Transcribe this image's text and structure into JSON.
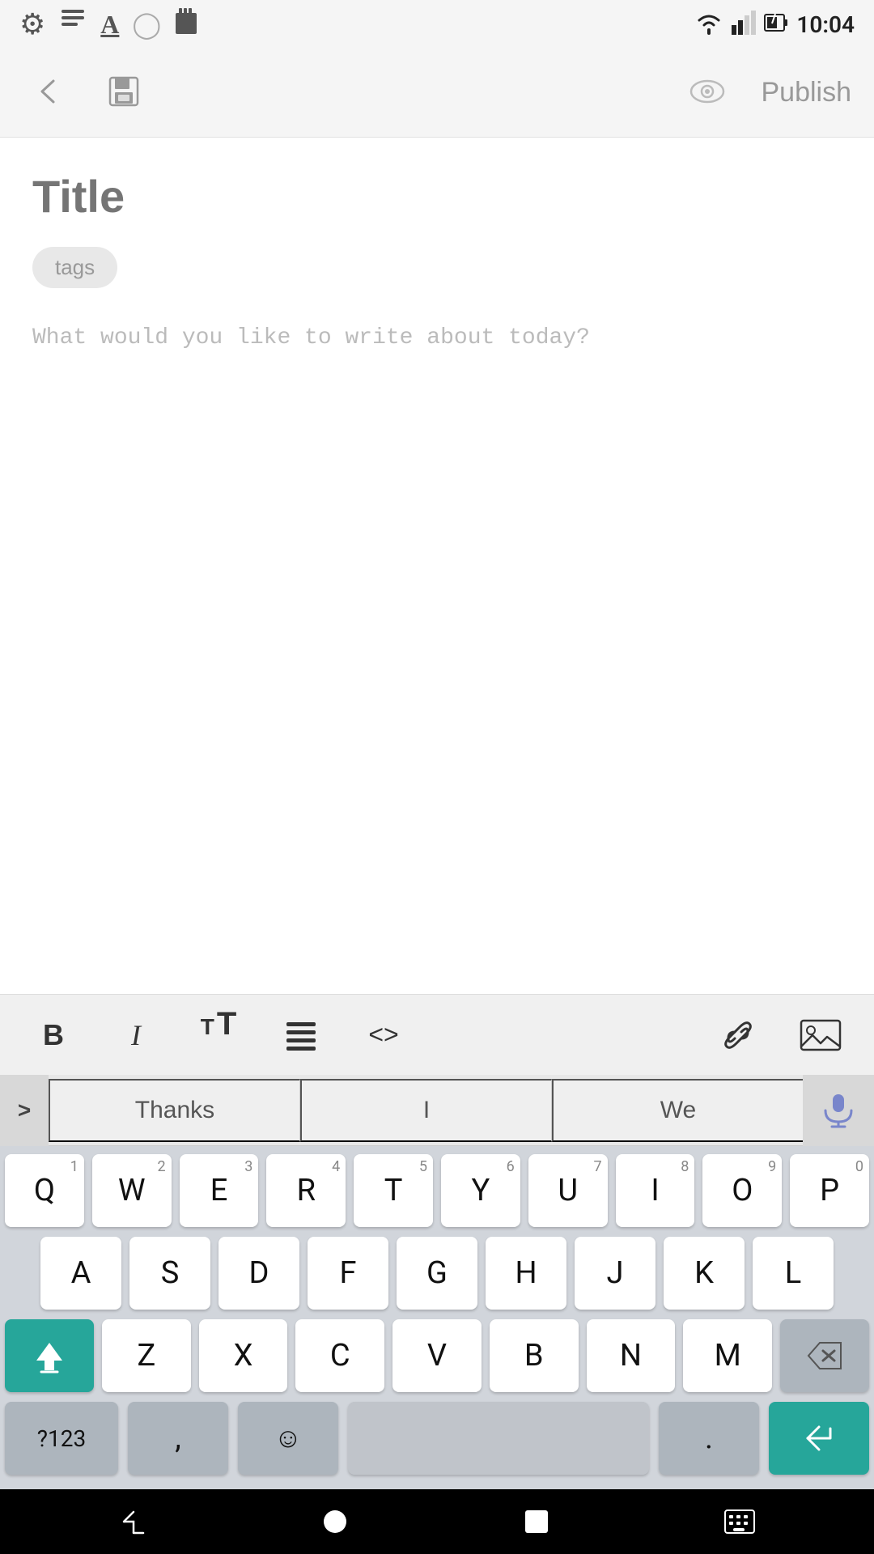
{
  "statusBar": {
    "time": "10:04",
    "icons": [
      "settings",
      "notes",
      "text",
      "circle",
      "sd"
    ]
  },
  "topBar": {
    "backLabel": "←",
    "saveLabel": "💾",
    "previewLabel": "👁",
    "publishLabel": "Publish"
  },
  "editor": {
    "titlePlaceholder": "Title",
    "tagsLabel": "tags",
    "bodyPlaceholder": "What would you like to write about today?"
  },
  "formatToolbar": {
    "boldLabel": "B",
    "italicLabel": "I",
    "textSizeLabel": "TT",
    "listLabel": "≡",
    "codeLabel": "<>",
    "linkLabel": "🔗",
    "imageLabel": "🖼"
  },
  "autocomplete": {
    "expandIcon": ">",
    "suggestions": [
      "Thanks",
      "I",
      "We"
    ],
    "micLabel": "🎤"
  },
  "keyboard": {
    "row1": [
      {
        "label": "Q",
        "num": "1"
      },
      {
        "label": "W",
        "num": "2"
      },
      {
        "label": "E",
        "num": "3"
      },
      {
        "label": "R",
        "num": "4"
      },
      {
        "label": "T",
        "num": "5"
      },
      {
        "label": "Y",
        "num": "6"
      },
      {
        "label": "U",
        "num": "7"
      },
      {
        "label": "I",
        "num": "8"
      },
      {
        "label": "O",
        "num": "9"
      },
      {
        "label": "P",
        "num": "0"
      }
    ],
    "row2": [
      {
        "label": "A"
      },
      {
        "label": "S"
      },
      {
        "label": "D"
      },
      {
        "label": "F"
      },
      {
        "label": "G"
      },
      {
        "label": "H"
      },
      {
        "label": "J"
      },
      {
        "label": "K"
      },
      {
        "label": "L"
      }
    ],
    "row3": [
      {
        "label": "Z"
      },
      {
        "label": "X"
      },
      {
        "label": "C"
      },
      {
        "label": "V"
      },
      {
        "label": "B"
      },
      {
        "label": "N"
      },
      {
        "label": "M"
      }
    ],
    "row4": [
      {
        "label": "?123"
      },
      {
        "label": ","
      },
      {
        "label": "☺"
      },
      {
        "label": ""
      },
      {
        "label": "."
      },
      {
        "label": "↵"
      }
    ]
  },
  "navBar": {
    "backLabel": "▽",
    "homeLabel": "●",
    "recentsLabel": "■",
    "keyboardLabel": "⌨"
  }
}
